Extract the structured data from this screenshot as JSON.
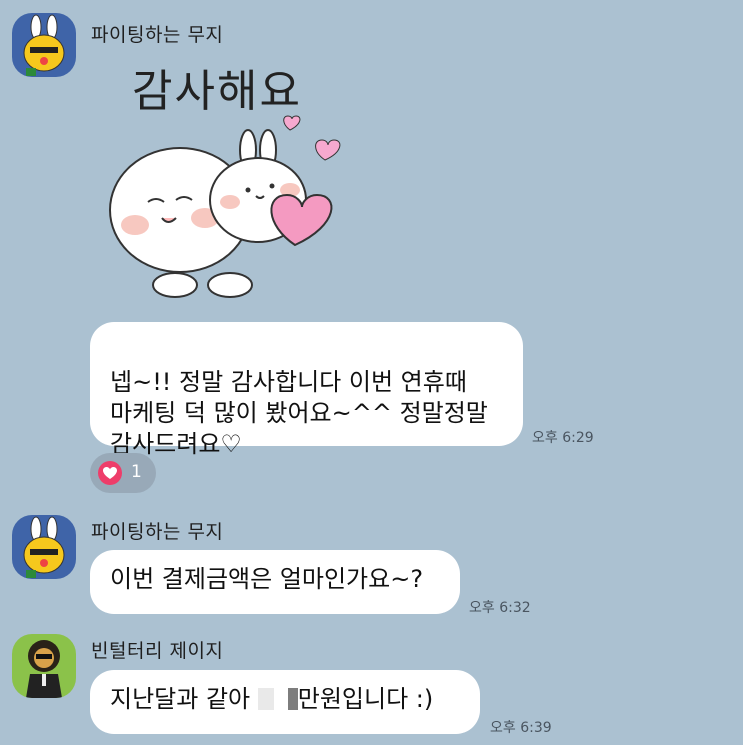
{
  "messages": [
    {
      "sender": "파이팅하는 무지",
      "sticker_text": "감사해요",
      "bubble_text": "넵~!!  정말 감사합니다 이번 연휴때\n마케팅 덕 많이 봤어요~^^  정말정말\n감사드려요♡",
      "time": "오후 6:29",
      "reaction": {
        "icon": "heart-icon",
        "count": "1",
        "color": "#ee3d6a"
      }
    },
    {
      "sender": "파이팅하는 무지",
      "bubble_text": "이번 결제금액은 얼마인가요~?",
      "time": "오후 6:32"
    },
    {
      "sender": "빈털터리 제이지",
      "bubble_before": "지난달과 같아 ",
      "bubble_after": "만원입니다 :)",
      "time": "오후 6:39"
    }
  ],
  "colors": {
    "background": "#abc1d1",
    "bubble": "#ffffff",
    "avatar_muzi_bg": "#3f64a8",
    "avatar_jayg_bg": "#8bc24a"
  }
}
